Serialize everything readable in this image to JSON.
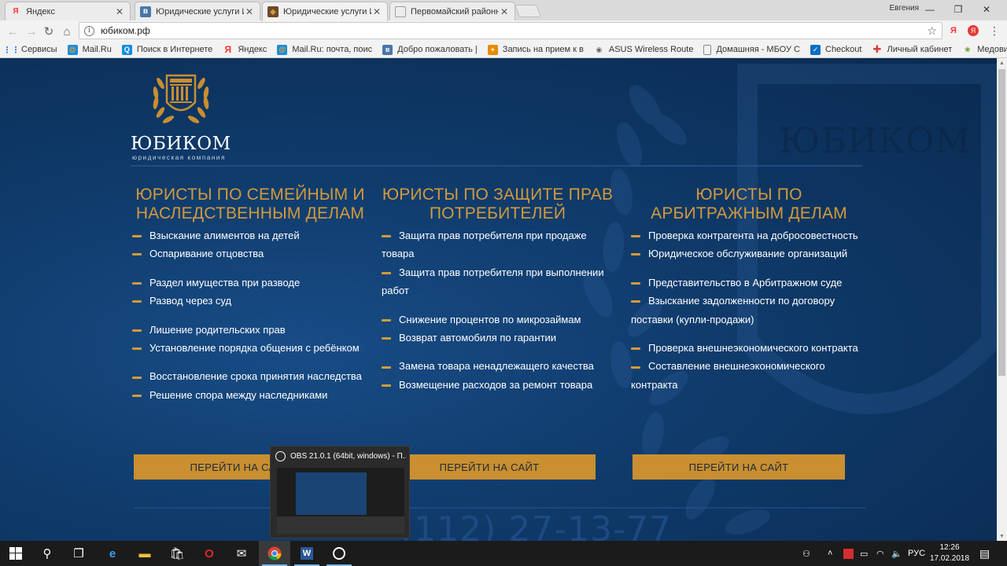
{
  "browser": {
    "tabs": [
      {
        "title": "Яндекс",
        "favicon": "yandex-icon",
        "color": "#ff3333"
      },
      {
        "title": "Юридические услуги Ив",
        "favicon": "vk-icon",
        "color": "#4a76a8"
      },
      {
        "title": "Юридические услуги Ив",
        "favicon": "site-icon",
        "color": "#6b4a2a"
      },
      {
        "title": "Первомайский районн",
        "favicon": "page-icon",
        "color": "#9e9e9e"
      }
    ],
    "user_name": "Евгения",
    "address": "юбиком.рф",
    "bookmarks": [
      {
        "label": "Сервисы",
        "icon": "apps-icon"
      },
      {
        "label": "Mail.Ru",
        "icon": "mailru-icon"
      },
      {
        "label": "Поиск в Интернете",
        "icon": "search-icon"
      },
      {
        "label": "Яндекс",
        "icon": "yandex-icon"
      },
      {
        "label": "Mail.Ru: почта, поис",
        "icon": "mailru-icon"
      },
      {
        "label": "Добро пожаловать |",
        "icon": "vk-icon"
      },
      {
        "label": "Запись на прием к в",
        "icon": "doctor-icon"
      },
      {
        "label": "ASUS Wireless Route",
        "icon": "router-icon"
      },
      {
        "label": "Домашняя - МБОУ С",
        "icon": "page-icon"
      },
      {
        "label": "Checkout",
        "icon": "checkout-icon"
      },
      {
        "label": "Личный кабинет",
        "icon": "cross-icon"
      },
      {
        "label": "Медовик - кулинар",
        "icon": "recipe-icon"
      }
    ]
  },
  "site": {
    "logo_name": "ЮБИКОМ",
    "logo_sub": "юридическая компания",
    "bg_brand": "ЮБИКОМ",
    "columns": [
      {
        "title": "ЮРИСТЫ ПО СЕМЕЙНЫМ И НАСЛЕДСТВЕННЫМ ДЕЛАМ",
        "items": [
          {
            "text": "Взыскание алиментов на детей",
            "gap": false
          },
          {
            "text": "Оспаривание отцовства",
            "gap": false
          },
          {
            "text": "Раздел имущества при разводе",
            "gap": true
          },
          {
            "text": "Развод через суд",
            "gap": false
          },
          {
            "text": "Лишение родительских прав",
            "gap": true
          },
          {
            "text": "Установление порядка общения с ребёнком",
            "gap": false
          },
          {
            "text": "Восстановление срока принятия наследства",
            "gap": true
          },
          {
            "text": "Решение спора между наследниками",
            "gap": false
          }
        ],
        "button": "ПЕРЕЙТИ НА САЙТ"
      },
      {
        "title": "ЮРИСТЫ ПО ЗАЩИТЕ ПРАВ ПОТРЕБИТЕЛЕЙ",
        "items": [
          {
            "text": "Защита прав потребителя при продаже товара",
            "gap": false
          },
          {
            "text": "Защита прав потребителя при выполнении работ",
            "gap": false
          },
          {
            "text": "Снижение процентов по микрозаймам",
            "gap": true
          },
          {
            "text": "Возврат автомобиля по гарантии",
            "gap": false
          },
          {
            "text": "Замена товара ненадлежащего качества",
            "gap": true
          },
          {
            "text": "Возмещение расходов за ремонт товара",
            "gap": false
          }
        ],
        "button": "ПЕРЕЙТИ НА САЙТ"
      },
      {
        "title": "ЮРИСТЫ ПО АРБИТРАЖНЫМ ДЕЛАМ",
        "items": [
          {
            "text": "Проверка контрагента на добросовестность",
            "gap": false
          },
          {
            "text": "Юридическое обслуживание организаций",
            "gap": false
          },
          {
            "text": "Представительство в Арбитражном суде",
            "gap": true
          },
          {
            "text": "Взыскание задолженности по договору поставки (купли-продажи)",
            "gap": false
          },
          {
            "text": "Проверка внешнеэкономического контракта",
            "gap": true
          },
          {
            "text": "Составление внешнеэкономического контракта",
            "gap": false
          }
        ],
        "button": "ПЕРЕЙТИ НА САЙТ"
      }
    ],
    "phone_partial": "(112) 27-13-77"
  },
  "obs_popup": {
    "title": "OBS 21.0.1 (64bit, windows) - П..."
  },
  "taskbar": {
    "language": "РУС",
    "time": "12:26",
    "date": "17.02.2018"
  },
  "colors": {
    "accent_gold": "#d39a3a",
    "button_gold": "#c98f30",
    "site_blue": "#0f3a6a"
  }
}
